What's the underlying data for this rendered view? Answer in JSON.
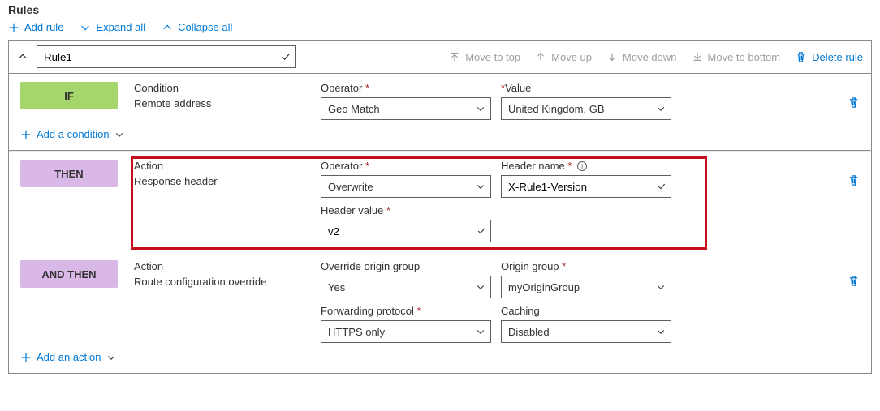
{
  "title": "Rules",
  "toolbar": {
    "add_rule": "Add rule",
    "expand": "Expand all",
    "collapse": "Collapse all"
  },
  "rule": {
    "name": "Rule1",
    "move_top": "Move to top",
    "move_up": "Move up",
    "move_down": "Move down",
    "move_bottom": "Move to bottom",
    "delete": "Delete rule"
  },
  "if": {
    "badge": "IF",
    "cond_label": "Condition",
    "cond_value": "Remote address",
    "op_label": "Operator",
    "op_value": "Geo Match",
    "val_label": "Value",
    "val_value": "United Kingdom, GB",
    "add": "Add a condition"
  },
  "then1": {
    "badge": "THEN",
    "act_label": "Action",
    "act_value": "Response header",
    "op_label": "Operator",
    "op_value": "Overwrite",
    "hname_label": "Header name",
    "hname_value": "X-Rule1-Version",
    "hval_label": "Header value",
    "hval_value": "v2"
  },
  "then2": {
    "badge": "AND THEN",
    "act_label": "Action",
    "act_value": "Route configuration override",
    "oog_label": "Override origin group",
    "oog_value": "Yes",
    "og_label": "Origin group",
    "og_value": "myOriginGroup",
    "fp_label": "Forwarding protocol",
    "fp_value": "HTTPS only",
    "cache_label": "Caching",
    "cache_value": "Disabled"
  },
  "add_action": "Add an action"
}
